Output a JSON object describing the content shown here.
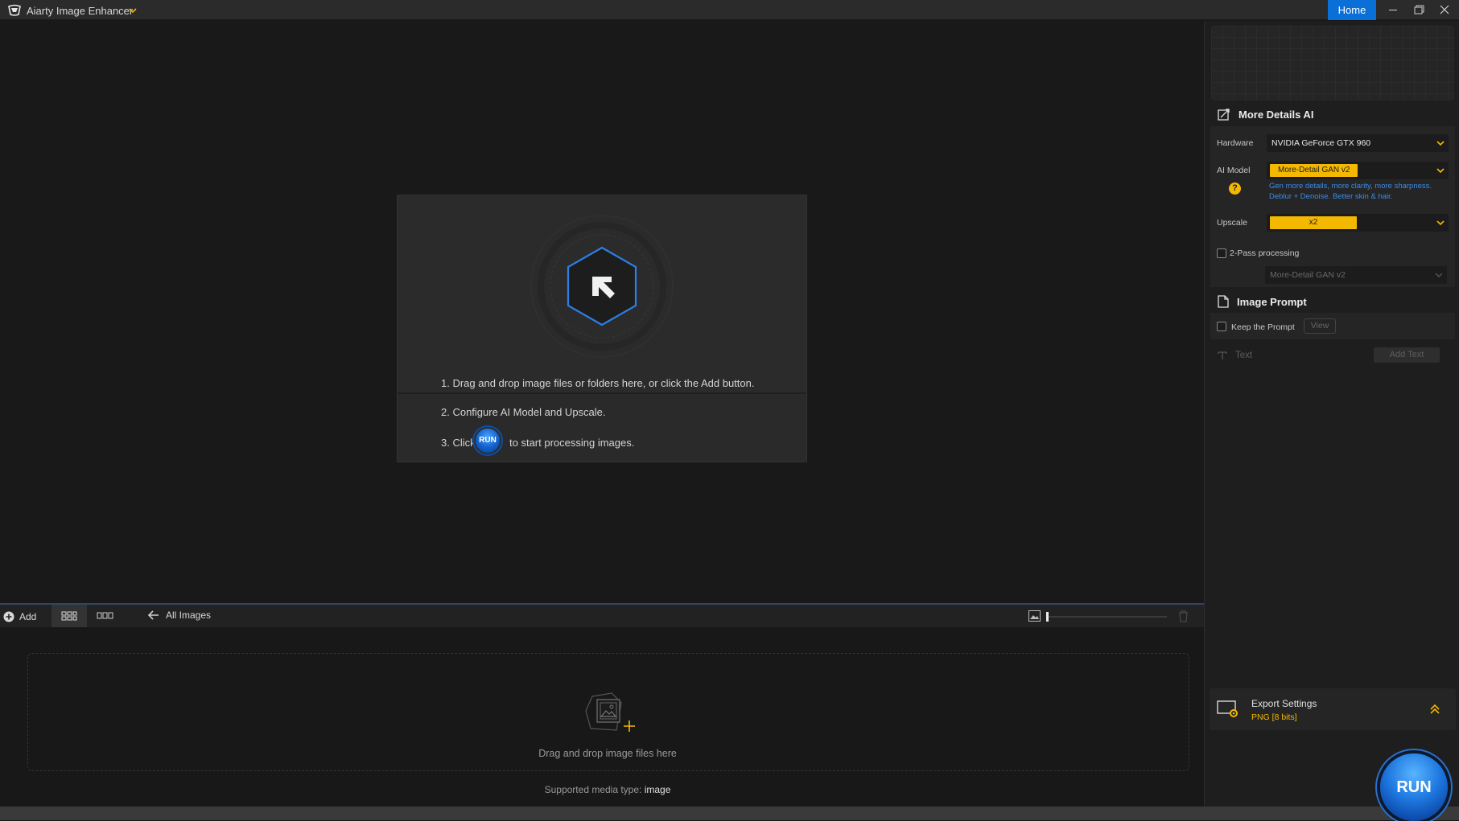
{
  "app": {
    "title": "Aiarty Image Enhancer",
    "home_label": "Home"
  },
  "guide": {
    "step1": "1. Drag and drop image files or folders here, or click the Add button.",
    "step2": "2. Configure AI Model and Upscale.",
    "step3_prefix": "3. Click",
    "step3_run": "RUN",
    "step3_suffix": "to start processing images."
  },
  "toolbar": {
    "add_label": "Add",
    "all_images_label": "All Images",
    "zoom_level": 0
  },
  "drop": {
    "text": "Drag and drop image files here",
    "supported_label": "Supported media type:",
    "supported_value": "image"
  },
  "panel": {
    "ai_section_title": "More Details AI",
    "hardware_label": "Hardware",
    "hardware_value": "NVIDIA GeForce GTX 960",
    "ai_model_label": "AI Model",
    "ai_model_value": "More-Detail GAN v2",
    "ai_model_desc": "Gen more details, more clarity, more sharpness. Deblur + Denoise. Better skin & hair.",
    "upscale_label": "Upscale",
    "upscale_value": "x2",
    "twopass_label": "2-Pass processing",
    "twopass_checked": false,
    "twopass_model": "More-Detail GAN v2",
    "prompt_section_title": "Image Prompt",
    "keep_prompt_label": "Keep the Prompt",
    "keep_prompt_checked": false,
    "view_label": "View",
    "text_label": "Text",
    "add_text_label": "Add Text",
    "export_title": "Export Settings",
    "export_format": "PNG   [8 bits]",
    "run_label": "RUN"
  },
  "colors": {
    "accent_blue": "#0a6fd6",
    "accent_yellow": "#f5b800",
    "desc_blue": "#3b8cea"
  }
}
